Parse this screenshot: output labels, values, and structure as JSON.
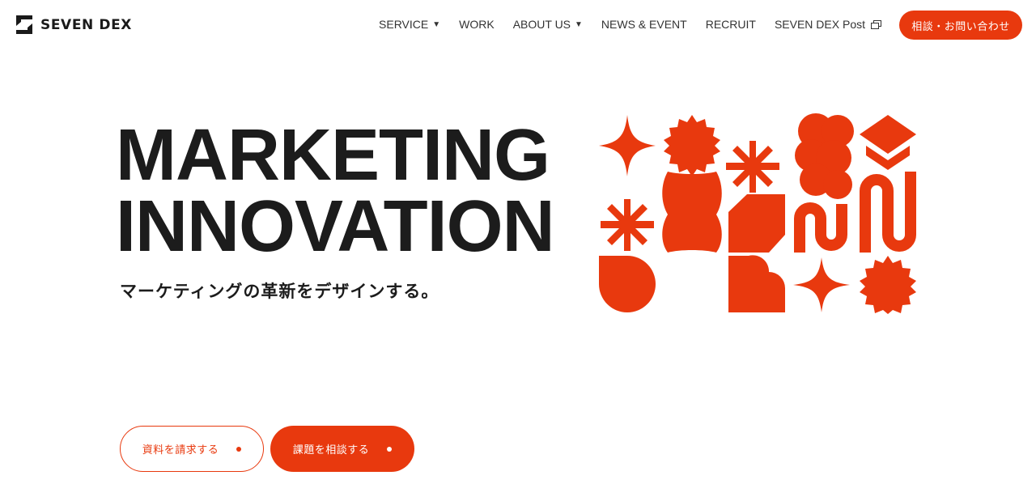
{
  "header": {
    "logo_text": "SEVEN DEX",
    "nav": [
      {
        "label": "SERVICE",
        "has_dropdown": true
      },
      {
        "label": "WORK",
        "has_dropdown": false
      },
      {
        "label": "ABOUT US",
        "has_dropdown": true
      },
      {
        "label": "NEWS & EVENT",
        "has_dropdown": false
      },
      {
        "label": "RECRUIT",
        "has_dropdown": false
      },
      {
        "label": "SEVEN DEX Post",
        "external": true
      }
    ],
    "caret_glyph": "▼",
    "cta_label": "相談・お問い合わせ"
  },
  "hero": {
    "title_line1": "MARKETING",
    "title_line2": "INNOVATION",
    "subtitle": "マーケティングの革新をデザインする。"
  },
  "buttons": {
    "request_docs": "資料を請求する",
    "consult": "課題を相談する"
  },
  "colors": {
    "accent": "#e8390e",
    "text": "#1c1c1c",
    "background": "#ffffff"
  },
  "icons": [
    "logo-mark-icon",
    "chevron-down-icon",
    "external-window-icon",
    "dot-icon"
  ]
}
